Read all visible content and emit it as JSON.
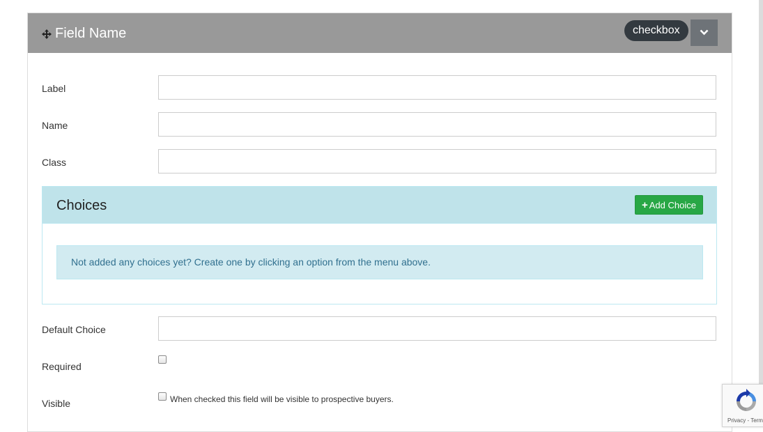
{
  "header": {
    "title": "Field Name",
    "type_badge": "checkbox"
  },
  "fields": {
    "label": {
      "label": "Label",
      "value": ""
    },
    "name": {
      "label": "Name",
      "value": ""
    },
    "class": {
      "label": "Class",
      "value": ""
    },
    "default_choice": {
      "label": "Default Choice",
      "value": ""
    },
    "required": {
      "label": "Required",
      "checked": false
    },
    "visible": {
      "label": "Visible",
      "checked": false,
      "help": "When checked this field will be visible to prospective buyers."
    }
  },
  "choices": {
    "title": "Choices",
    "add_button_label": "Add Choice",
    "empty_message": "Not added any choices yet? Create one by clicking an option from the menu above."
  },
  "recaptcha": {
    "footer": "Privacy - Terms"
  },
  "colors": {
    "header_bg": "#999999",
    "badge_bg": "#333a40",
    "choices_header_bg": "#bfe3ea",
    "alert_bg": "#d2ebf1",
    "alert_text": "#31708f",
    "add_button": "#28a745"
  }
}
